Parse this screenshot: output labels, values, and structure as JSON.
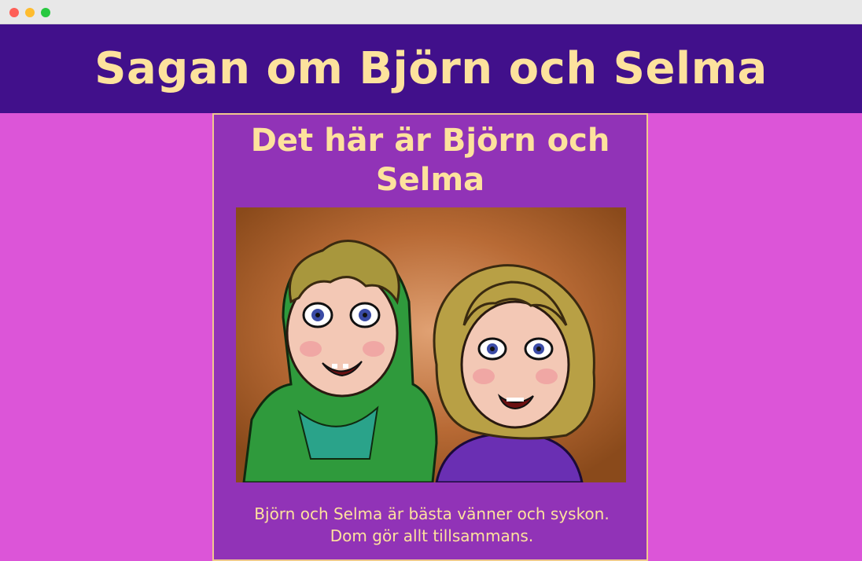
{
  "window": {
    "controls": [
      "close",
      "minimize",
      "maximize"
    ]
  },
  "header": {
    "title": "Sagan om Björn och Selma"
  },
  "card": {
    "heading": "Det här är Björn och Selma",
    "image_alt": "Illustration of Björn in a green hoodie and Selma in a purple shirt",
    "caption": "Björn och Selma är bästa vänner och syskon. Dom gör allt tillsammans."
  },
  "colors": {
    "header_bg": "#41108b",
    "page_bg": "#dc55d8",
    "card_bg": "#9133b7",
    "text_accent": "#fde29d"
  }
}
